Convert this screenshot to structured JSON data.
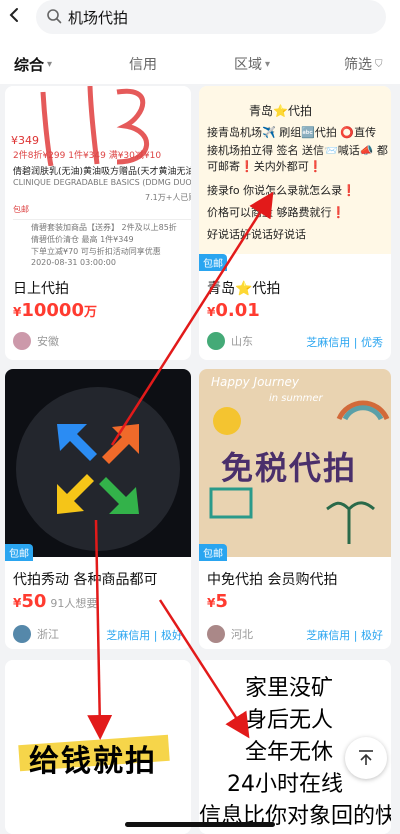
{
  "search": {
    "query": "机场代拍"
  },
  "tabs": [
    {
      "label": "综合"
    },
    {
      "label": "信用"
    },
    {
      "label": "区域"
    },
    {
      "label": "筛选"
    }
  ],
  "cards": [
    {
      "image": {
        "price": "¥349",
        "discounts": "2件8折¥299  1件¥349  满¥30减¥10",
        "product_line": "倩碧润肤乳(无油)黄油吸方赠品(天才黄油无油)",
        "product_sub": "CLINIQUE DEGRADABLE BASICS (DDMG DUO) 250ml",
        "sales": "7.1万+人已购",
        "shipping": "包邮",
        "promo_lines": [
          "倩碧套装加商品【送券】 2件及以上85折",
          "倩碧低价清仓 最高 1件¥349",
          "下单立减¥70 可与折扣活动同享优惠",
          "2020-08-31 03:00:00"
        ]
      },
      "title": "日上代拍",
      "price": {
        "currency": "¥",
        "value": "10000",
        "unit": "万"
      },
      "seller": {
        "location": "安徽"
      }
    },
    {
      "image": {
        "lines": [
          "青岛⭐代拍",
          "接青岛机场✈️ 刷组🔤代拍 ⭕直传",
          "接机场拍立得 签名 送信📨喊话📣 都",
          "可邮寄❗关内外都可❗",
          "接录fo 你说怎么录就怎么录❗",
          "价格可以商量 够路费就行❗",
          "好说话好说话好说话"
        ]
      },
      "tag": "包邮",
      "title": "青岛⭐代拍",
      "price": {
        "currency": "¥",
        "value": "0.01"
      },
      "seller": {
        "location": "山东"
      },
      "credit": "芝麻信用 | 优秀"
    },
    {
      "tag": "包邮",
      "title": "代拍秀动 各种商品都可",
      "price": {
        "currency": "¥",
        "value": "50"
      },
      "wants": "91人想要",
      "seller": {
        "location": "浙江"
      },
      "credit": "芝麻信用 | 极好"
    },
    {
      "image": {
        "headline": "免税代拍",
        "script_top": "Happy Journey",
        "script_sub": "in summer"
      },
      "tag": "包邮",
      "title": "中免代拍  会员购代拍",
      "price": {
        "currency": "¥",
        "value": "5"
      },
      "seller": {
        "location": "河北"
      },
      "credit": "芝麻信用 | 极好"
    },
    {
      "image": {
        "text": "给钱就拍"
      }
    },
    {
      "image": {
        "lines": [
          "家里没矿",
          "身后无人",
          "全年无休",
          "24小时在线",
          "信息比你对象回的快"
        ]
      }
    }
  ],
  "accent_red": "#ff3b30",
  "accent_blue": "#2aa5f0",
  "arrow_color": "#e21a1a"
}
